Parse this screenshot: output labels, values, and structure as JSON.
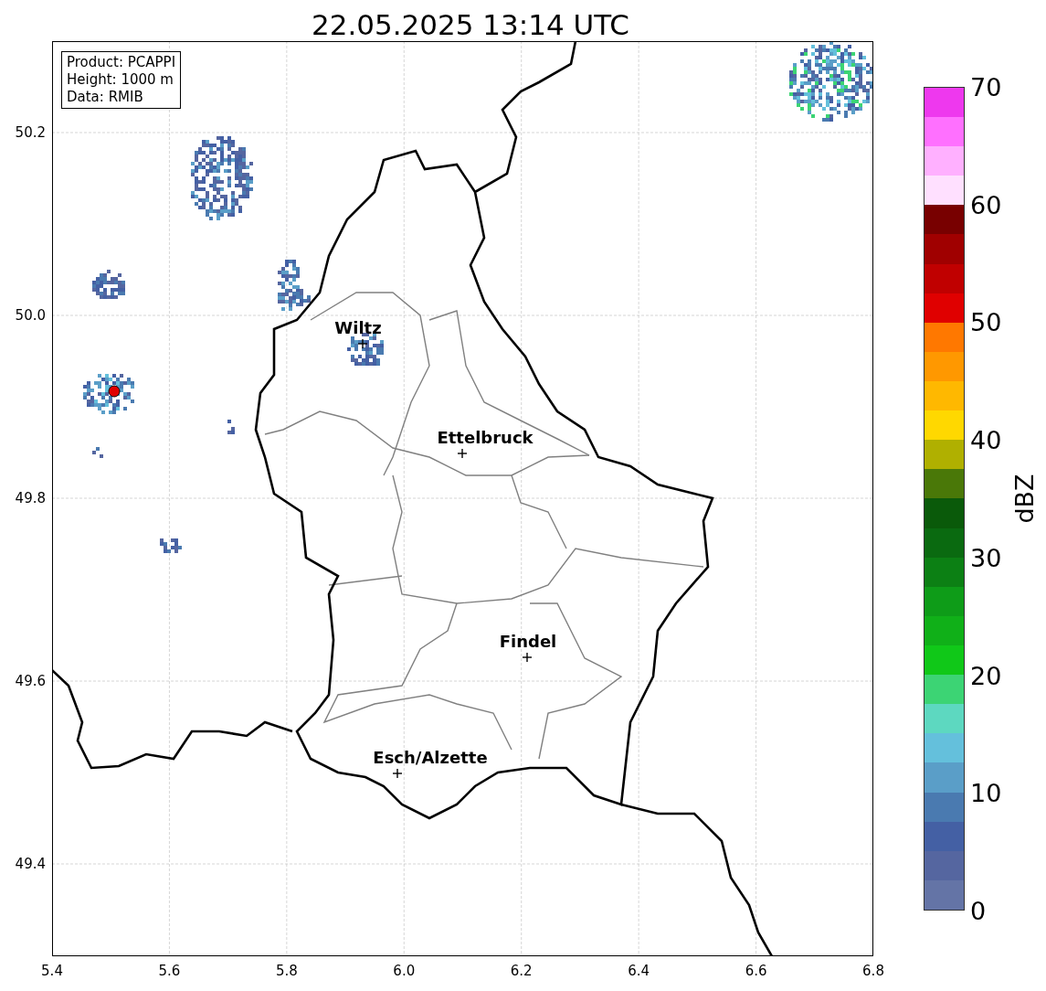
{
  "title": "22.05.2025 13:14 UTC",
  "legend": [
    "Product: PCAPPI",
    "Height: 1000 m",
    "Data: RMIB"
  ],
  "cities": [
    {
      "name": "Wiltz"
    },
    {
      "name": "Ettelbruck"
    },
    {
      "name": "Findel"
    },
    {
      "name": "Esch/Alzette"
    }
  ],
  "x_ticks": [
    "5.4",
    "5.6",
    "5.8",
    "6.0",
    "6.2",
    "6.4",
    "6.6",
    "6.8"
  ],
  "y_ticks": [
    "50.2",
    "50.0",
    "49.8",
    "49.6",
    "49.4"
  ],
  "colorbar": {
    "label": "dBZ",
    "ticks": [
      "70",
      "60",
      "50",
      "40",
      "30",
      "20",
      "10",
      "0"
    ],
    "bands": [
      {
        "color": "#6474a6"
      },
      {
        "color": "#5566a0"
      },
      {
        "color": "#4460a4"
      },
      {
        "color": "#4a7ab0"
      },
      {
        "color": "#5a9ec8"
      },
      {
        "color": "#64c0dc"
      },
      {
        "color": "#5dd8c0"
      },
      {
        "color": "#3cd474"
      },
      {
        "color": "#10c818"
      },
      {
        "color": "#10b018"
      },
      {
        "color": "#0e9c18"
      },
      {
        "color": "#0c8014"
      },
      {
        "color": "#0a6a10"
      },
      {
        "color": "#0a5a0a"
      },
      {
        "color": "#4a7808"
      },
      {
        "color": "#b0b000"
      },
      {
        "color": "#ffd800"
      },
      {
        "color": "#ffb800"
      },
      {
        "color": "#ff9800"
      },
      {
        "color": "#ff7800"
      },
      {
        "color": "#e00000"
      },
      {
        "color": "#c00000"
      },
      {
        "color": "#a00000"
      },
      {
        "color": "#780000"
      },
      {
        "color": "#ffe0ff"
      },
      {
        "color": "#ffb0ff"
      },
      {
        "color": "#ff70ff"
      },
      {
        "color": "#ee38ee"
      }
    ]
  }
}
